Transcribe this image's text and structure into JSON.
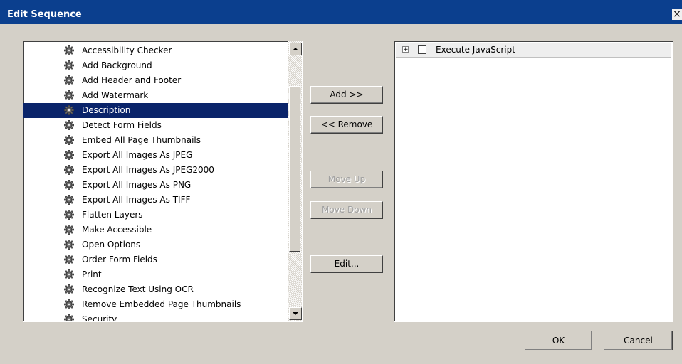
{
  "dialog": {
    "title": "Edit Sequence",
    "close_label": "×"
  },
  "commands": {
    "items": [
      "Accessibility Checker",
      "Add Background",
      "Add Header and Footer",
      "Add Watermark",
      "Description",
      "Detect Form Fields",
      "Embed All Page Thumbnails",
      "Export All Images As JPEG",
      "Export All Images As JPEG2000",
      "Export All Images As PNG",
      "Export All Images As TIFF",
      "Flatten Layers",
      "Make Accessible",
      "Open Options",
      "Order Form Fields",
      "Print",
      "Recognize Text Using OCR",
      "Remove Embedded Page Thumbnails",
      "Security"
    ],
    "selected": "Description",
    "item_icon": "gear-icon"
  },
  "buttons": {
    "add": "Add >>",
    "remove": "<< Remove",
    "move_up": "Move Up",
    "move_down": "Move Down",
    "edit": "Edit...",
    "ok": "OK",
    "cancel": "Cancel"
  },
  "sequence": {
    "items": [
      {
        "label": "Execute JavaScript",
        "checked": false,
        "expander": "+"
      }
    ]
  },
  "colors": {
    "titlebar": "#0b3f8e",
    "selection": "#0a246a",
    "dialog_bg": "#d4d0c8"
  }
}
